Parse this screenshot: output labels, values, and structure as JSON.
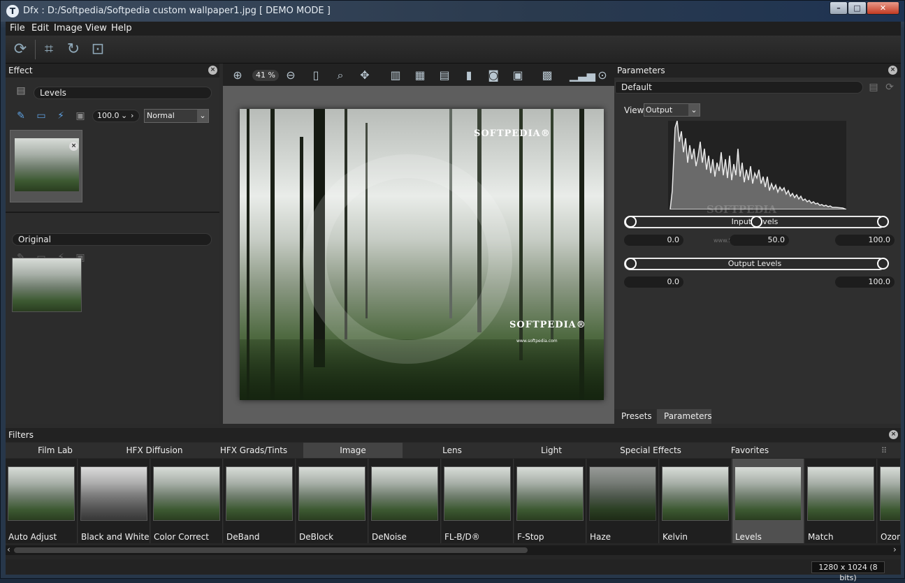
{
  "window": {
    "title": "Dfx : D:/Softpedia/Softpedia custom wallpaper1.jpg [ DEMO MODE ]",
    "logo": "T",
    "controls": [
      "–",
      "□",
      "✕"
    ]
  },
  "menu": [
    "File",
    "Edit",
    "Image",
    "View",
    "Help"
  ],
  "toolbar_icons": [
    "refresh-icon",
    "crop-icon",
    "rotate-icon",
    "fit-icon"
  ],
  "effect": {
    "title": "Effect",
    "layer_name": "Levels",
    "opacity": "100.0",
    "blend_mode": "Normal",
    "original_label": "Original"
  },
  "canvas": {
    "zoom": "41 %",
    "watermark_top": "SOFTPEDIA®",
    "watermark_bottom": "SOFTPEDIA®",
    "watermark_url": "www.softpedia.com"
  },
  "params": {
    "title": "Parameters",
    "preset": "Default",
    "view_label": "View",
    "view_value": "Output",
    "input_levels_label": "Input Levels",
    "output_levels_label": "Output Levels",
    "input_values": [
      "0.0",
      "50.0",
      "100.0"
    ],
    "output_values": [
      "0.0",
      "100.0"
    ],
    "tabs": [
      "Presets",
      "Parameters"
    ],
    "active_tab": "Parameters",
    "histogram_watermark": "SOFTPEDIA",
    "histogram_watermark_url": "www.Softpedia.com"
  },
  "filters": {
    "title": "Filters",
    "categories": [
      "Film Lab",
      "HFX Diffusion",
      "HFX Grads/Tints",
      "Image",
      "Lens",
      "Light",
      "Special Effects",
      "Favorites"
    ],
    "active_category": "Image",
    "items": [
      "Auto Adjust",
      "Black and White",
      "Color Correct",
      "DeBand",
      "DeBlock",
      "DeNoise",
      "FL-B/D®",
      "F-Stop",
      "Haze",
      "Kelvin",
      "Levels",
      "Match",
      "Ozone"
    ],
    "active_item": "Levels"
  },
  "status": {
    "image_info": "1280 x 1024 (8 bits)"
  }
}
